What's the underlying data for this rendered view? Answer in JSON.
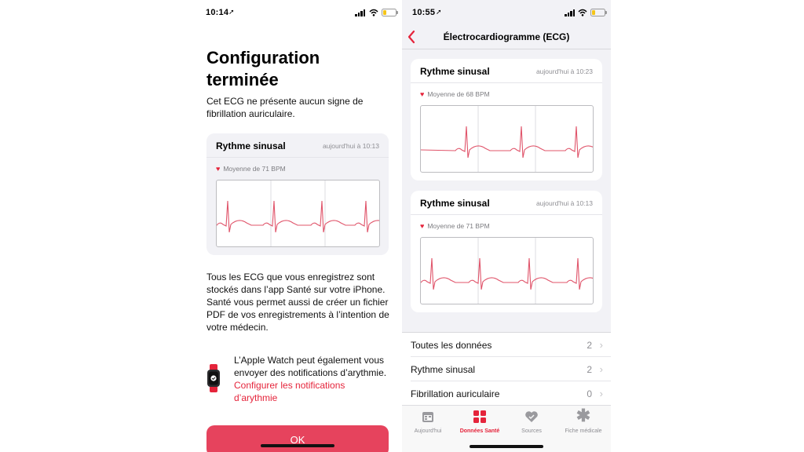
{
  "left_screen": {
    "status": {
      "time": "10:14"
    },
    "title": "Configuration terminée",
    "intro": "Cet ECG ne présente aucun signe de fibrillation auriculaire.",
    "card": {
      "title": "Rythme sinusal",
      "date": "aujourd'hui à 10:13",
      "bpm": "Moyenne de 71 BPM"
    },
    "storage_text": "Tous les ECG que vous enregistrez sont stockés dans l’app Santé sur votre iPhone. Santé vous permet aussi de créer un fichier PDF de vos enregistrements à l’intention de votre médecin.",
    "watch_text": "L’Apple Watch peut également vous envoyer des notifications d’arythmie.",
    "watch_link": "Configurer les notifications d’arythmie",
    "ok_button": "OK"
  },
  "right_screen": {
    "status": {
      "time": "10:55"
    },
    "nav_title": "Électrocardiogramme (ECG)",
    "cards": [
      {
        "title": "Rythme sinusal",
        "date": "aujourd'hui à 10:23",
        "bpm": "Moyenne de 68 BPM"
      },
      {
        "title": "Rythme sinusal",
        "date": "aujourd'hui à 10:13",
        "bpm": "Moyenne de 71 BPM"
      }
    ],
    "list": [
      {
        "label": "Toutes les données",
        "count": "2"
      },
      {
        "label": "Rythme sinusal",
        "count": "2"
      },
      {
        "label": "Fibrillation auriculaire",
        "count": "0"
      }
    ],
    "tabs": [
      {
        "label": "Aujourd'hui",
        "icon": "calendar-icon",
        "active": false
      },
      {
        "label": "Données Santé",
        "icon": "grid-icon",
        "active": true
      },
      {
        "label": "Sources",
        "icon": "heart-sources-icon",
        "active": false
      },
      {
        "label": "Fiche médicale",
        "icon": "asterisk-icon",
        "active": false
      }
    ]
  },
  "colors": {
    "accent": "#e5243b",
    "ecg_line": "#e0546a",
    "background": "#f2f2f6"
  }
}
